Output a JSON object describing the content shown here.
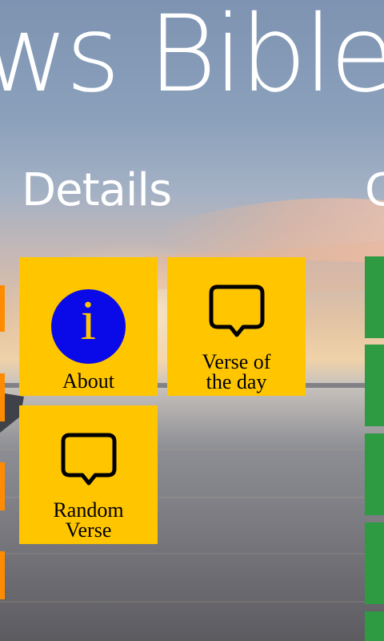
{
  "app": {
    "title": "ws Bible"
  },
  "sections": {
    "details": {
      "title": "Details"
    },
    "next": {
      "title": "C"
    }
  },
  "tiles": {
    "about": {
      "label": "About",
      "icon": "info-icon",
      "glyph": "i"
    },
    "verse_of_day": {
      "label_line1": "Verse of",
      "label_line2": "the day",
      "icon": "speech-bubble-icon"
    },
    "random_verse": {
      "label_line1": "Random",
      "label_line2": "Verse",
      "icon": "speech-bubble-icon"
    }
  },
  "colors": {
    "tile": "#ffc600",
    "info_circle": "#0a0ae8",
    "edge_tile": "#ff8c00",
    "green_tile": "#2e9a42",
    "text": "#ffffff"
  }
}
